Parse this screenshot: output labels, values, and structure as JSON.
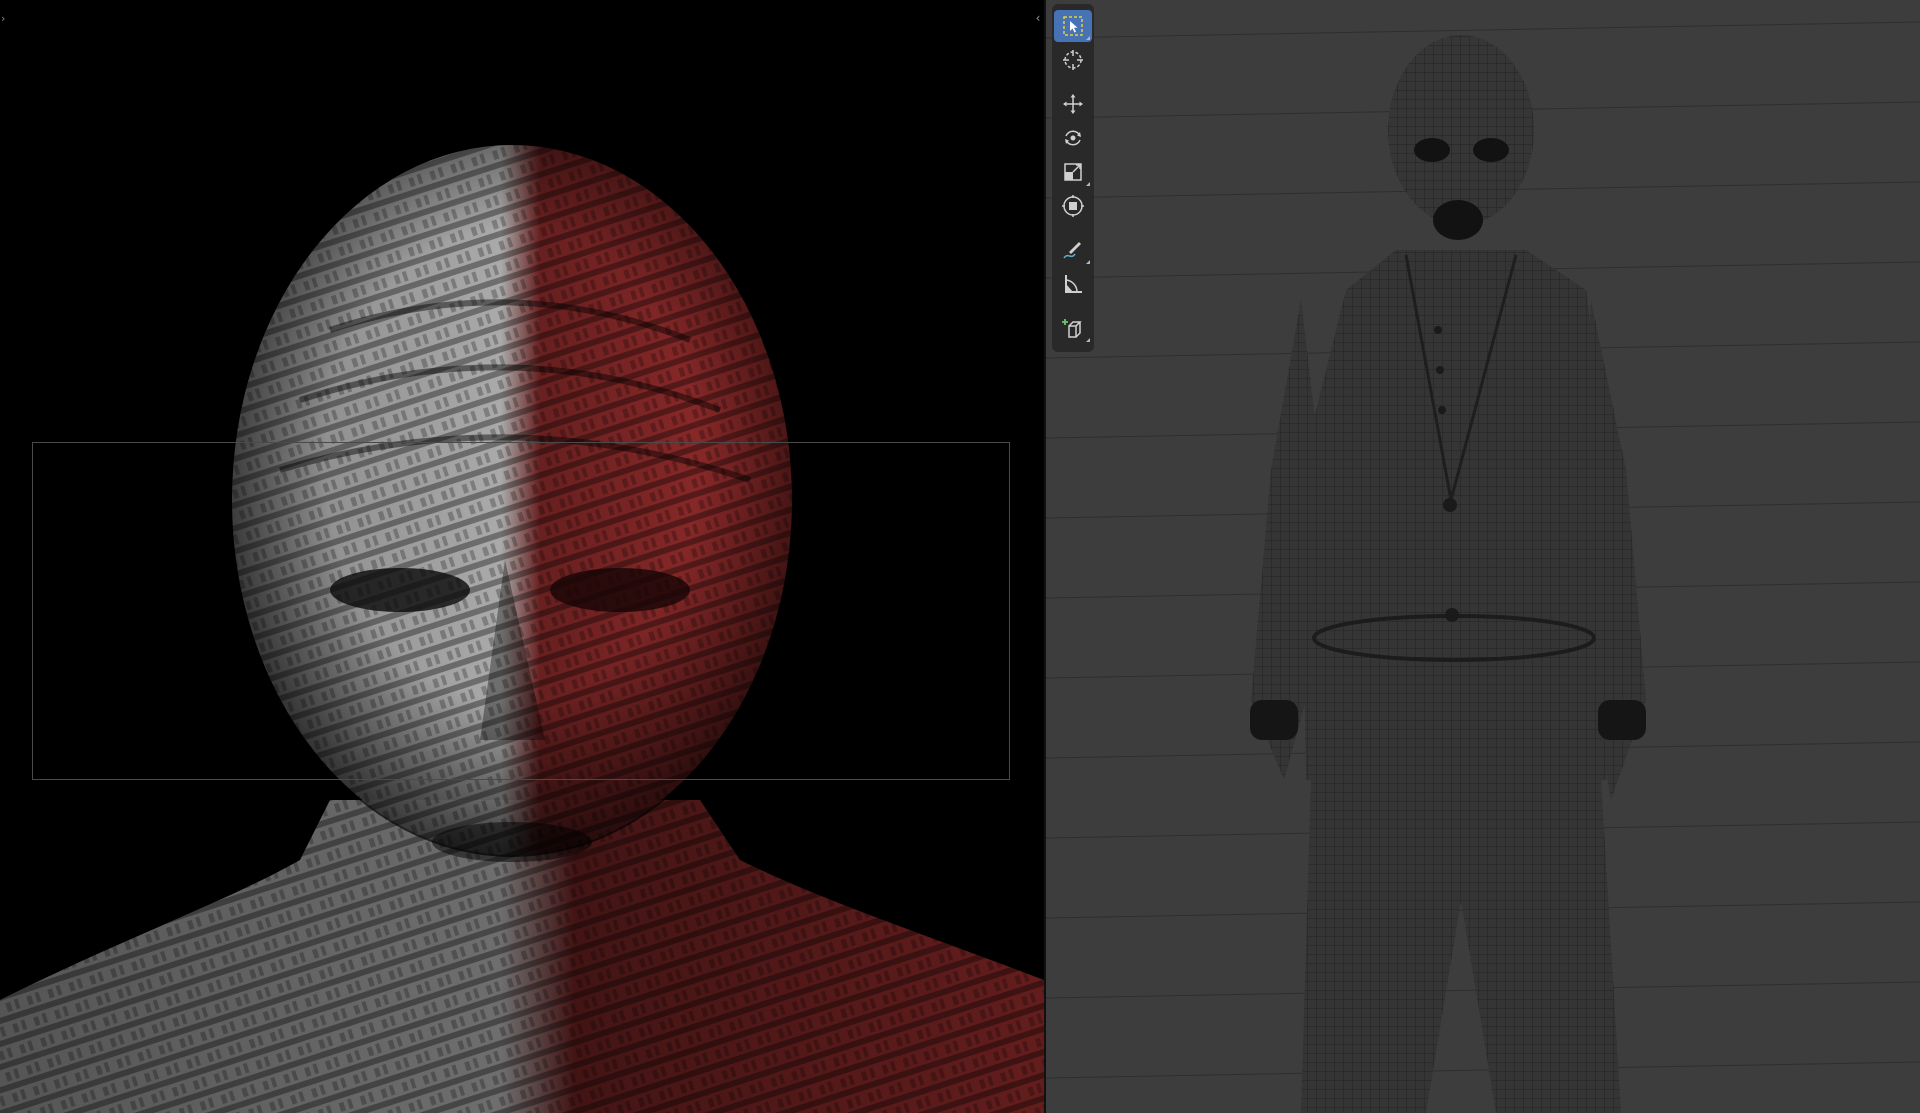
{
  "left_panel": {
    "collapse_glyph": "›"
  },
  "toolbar": {
    "collapse_glyph": "‹",
    "tools": [
      {
        "name": "select-box",
        "icon": "select-box-icon",
        "active": true
      },
      {
        "name": "cursor",
        "icon": "cursor-icon",
        "active": false
      },
      {
        "name": "move",
        "icon": "move-icon",
        "active": false
      },
      {
        "name": "rotate",
        "icon": "rotate-icon",
        "active": false
      },
      {
        "name": "scale",
        "icon": "scale-icon",
        "active": false
      },
      {
        "name": "transform",
        "icon": "transform-icon",
        "active": false
      },
      {
        "name": "annotate",
        "icon": "annotate-icon",
        "active": false
      },
      {
        "name": "measure",
        "icon": "measure-icon",
        "active": false
      },
      {
        "name": "add-cube",
        "icon": "add-cube-icon",
        "active": false
      }
    ]
  },
  "colors": {
    "viewport_bg": "#3d3d3d",
    "render_bg": "#000000",
    "toolbar_bg": "#282828",
    "active_tool": "#4772b3",
    "wire": "#1e1e1e",
    "face_light": "#d8d8d8",
    "face_red": "#b02a2a"
  }
}
